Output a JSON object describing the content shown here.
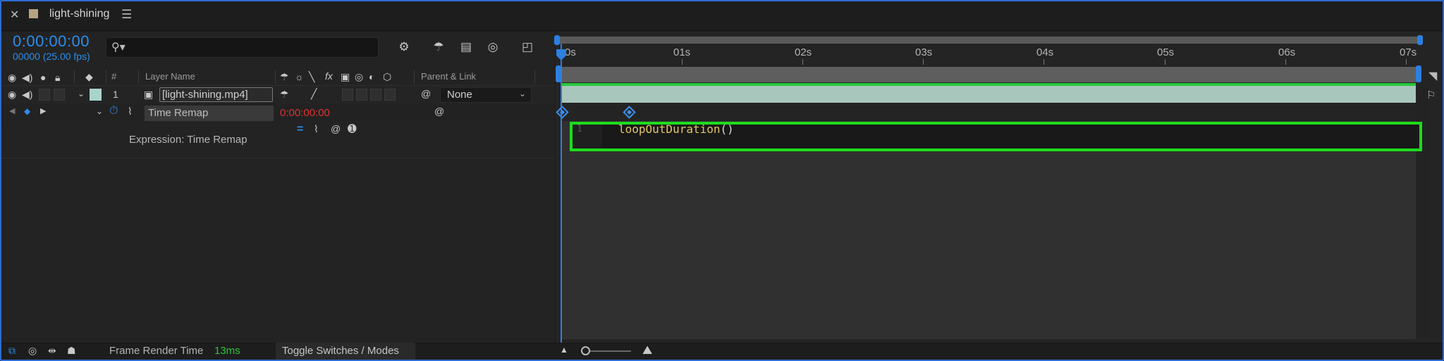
{
  "tab": {
    "title": "light-shining",
    "close_icon": "close-icon",
    "menu_icon": "hamburger-menu-icon",
    "swatch_color": "#b7a381"
  },
  "comp": {
    "timecode": "0:00:00:00",
    "frames": "00000 (25.00 fps)"
  },
  "search": {
    "placeholder": ""
  },
  "columns": {
    "number": "#",
    "layer_name": "Layer Name",
    "parent_link": "Parent & Link"
  },
  "layer": {
    "number": "1",
    "name": "[light-shining.mp4]",
    "label_color": "#a9d4cc",
    "parent": "None"
  },
  "property": {
    "name": "Time Remap",
    "value": "0:00:00:00",
    "value_color": "#e03232"
  },
  "expression": {
    "label": "Expression: Time Remap",
    "line_number": "1",
    "code_fn": "loopOutDuration",
    "code_parens": "()"
  },
  "ruler": {
    "labels": [
      "0s",
      "01s",
      "02s",
      "03s",
      "04s",
      "05s",
      "06s",
      "07s"
    ]
  },
  "bottom": {
    "render_label": "Frame Render Time",
    "render_value": "13ms",
    "toggle_label": "Toggle Switches / Modes"
  },
  "colors": {
    "accent": "#2d8ceb",
    "highlight": "#1ddc1d",
    "layer_bar": "#a9c6bd"
  }
}
